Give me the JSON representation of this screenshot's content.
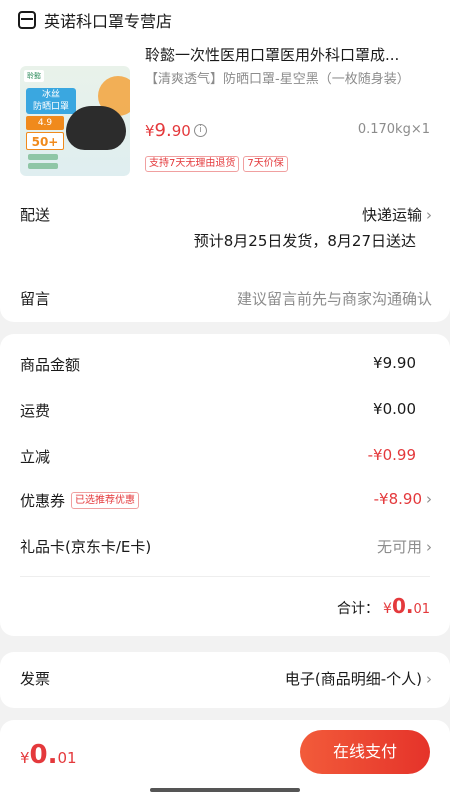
{
  "store": {
    "name": "英诺科口罩专营店",
    "icon": "store-icon"
  },
  "product": {
    "title": "聆懿一次性医用口罩医用外科口罩成...",
    "spec": "【清爽透气】防晒口罩-星空黑（一枚随身装）",
    "price_symbol": "¥",
    "price_int": "9.",
    "price_dec": "90",
    "weight": "0.170kg×1",
    "badges": [
      "支持7天无理由退货",
      "7天价保"
    ],
    "thumb_text": {
      "brand": "聆懿",
      "tag1": "冰丝\n防晒口罩",
      "tag2": "4.9",
      "tag3": "50+"
    }
  },
  "delivery": {
    "label": "配送",
    "method": "快递运输",
    "estimate": "预计8月25日发货，8月27日送达"
  },
  "message": {
    "label": "留言",
    "placeholder": "建议留言前先与商家沟通确认"
  },
  "costs": {
    "goods_amount": {
      "label": "商品金额",
      "value": "¥9.90"
    },
    "shipping": {
      "label": "运费",
      "value": "¥0.00"
    },
    "discount": {
      "label": "立减",
      "value": "-¥0.99"
    },
    "coupon": {
      "label": "优惠券",
      "badge": "已选推荐优惠",
      "value": "-¥8.90"
    },
    "gift_card": {
      "label": "礼品卡(京东卡/E卡)",
      "value": "无可用"
    },
    "total": {
      "label": "合计：",
      "symbol": "¥",
      "int": "0.",
      "dec": "01"
    }
  },
  "invoice": {
    "label": "发票",
    "value": "电子(商品明细-个人)"
  },
  "bottom": {
    "symbol": "¥",
    "int": "0.",
    "dec": "01",
    "pay_label": "在线支付"
  },
  "colors": {
    "accent": "#e4393c",
    "button": "#e5332a"
  }
}
